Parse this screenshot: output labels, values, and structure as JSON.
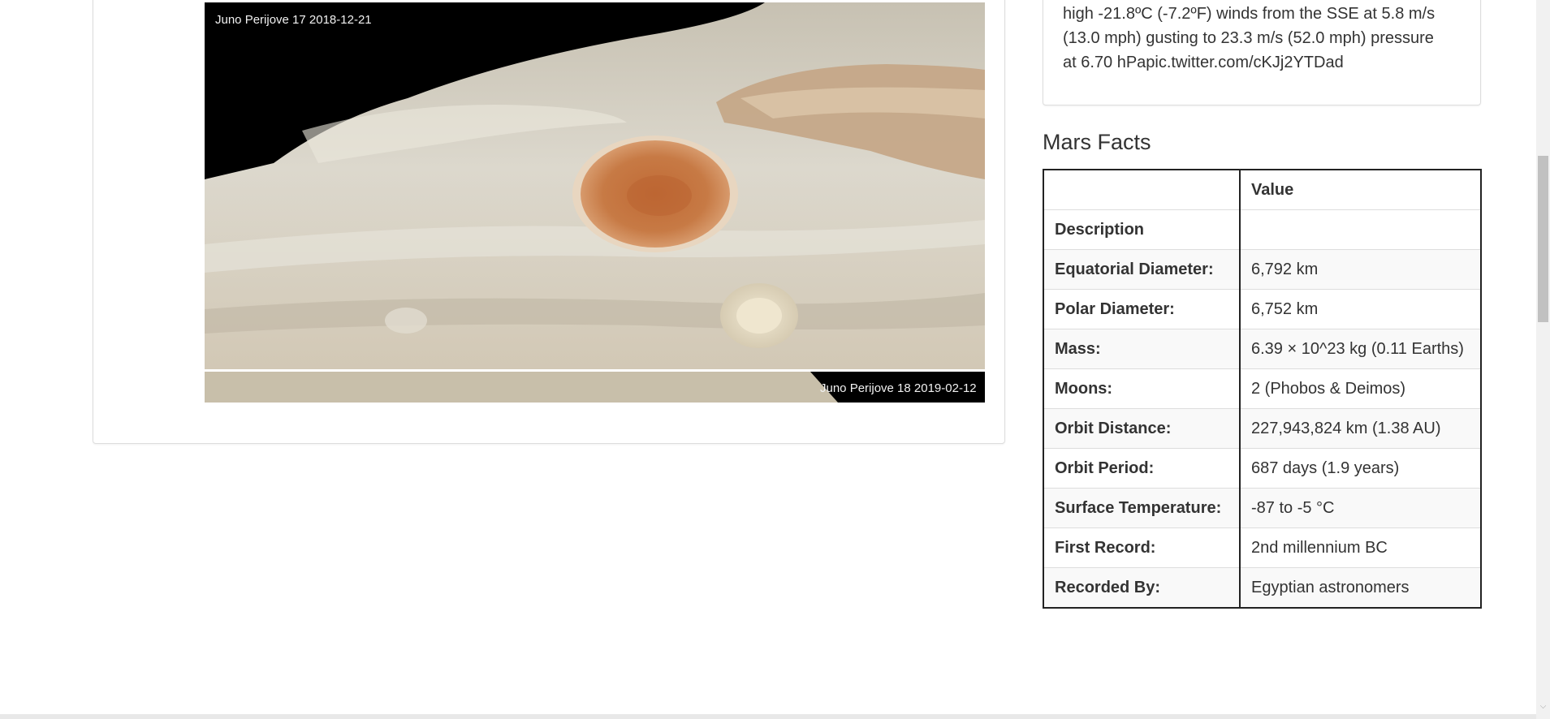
{
  "image": {
    "caption_top": "Juno Perijove 17 2018-12-21",
    "caption_bottom": "Juno Perijove 18 2019-02-12"
  },
  "weather": {
    "lines": [
      "high -21.8ºC (-7.2ºF) winds from the SSE at 5.8 m/s",
      "(13.0 mph) gusting to 23.3 m/s (52.0 mph) pressure",
      "at 6.70 hPapic.twitter.com/cKJj2YTDad"
    ]
  },
  "facts": {
    "title": "Mars Facts",
    "header_value": "Value",
    "rows": [
      {
        "label": "Description",
        "value": ""
      },
      {
        "label": "Equatorial Diameter:",
        "value": "6,792 km"
      },
      {
        "label": "Polar Diameter:",
        "value": "6,752 km"
      },
      {
        "label": "Mass:",
        "value": "6.39 × 10^23 kg (0.11 Earths)"
      },
      {
        "label": "Moons:",
        "value": "2 (Phobos & Deimos)"
      },
      {
        "label": "Orbit Distance:",
        "value": "227,943,824 km (1.38 AU)"
      },
      {
        "label": "Orbit Period:",
        "value": "687 days (1.9 years)"
      },
      {
        "label": "Surface Temperature:",
        "value": "-87 to -5 °C"
      },
      {
        "label": "First Record:",
        "value": "2nd millennium BC"
      },
      {
        "label": "Recorded By:",
        "value": "Egyptian astronomers"
      }
    ]
  }
}
